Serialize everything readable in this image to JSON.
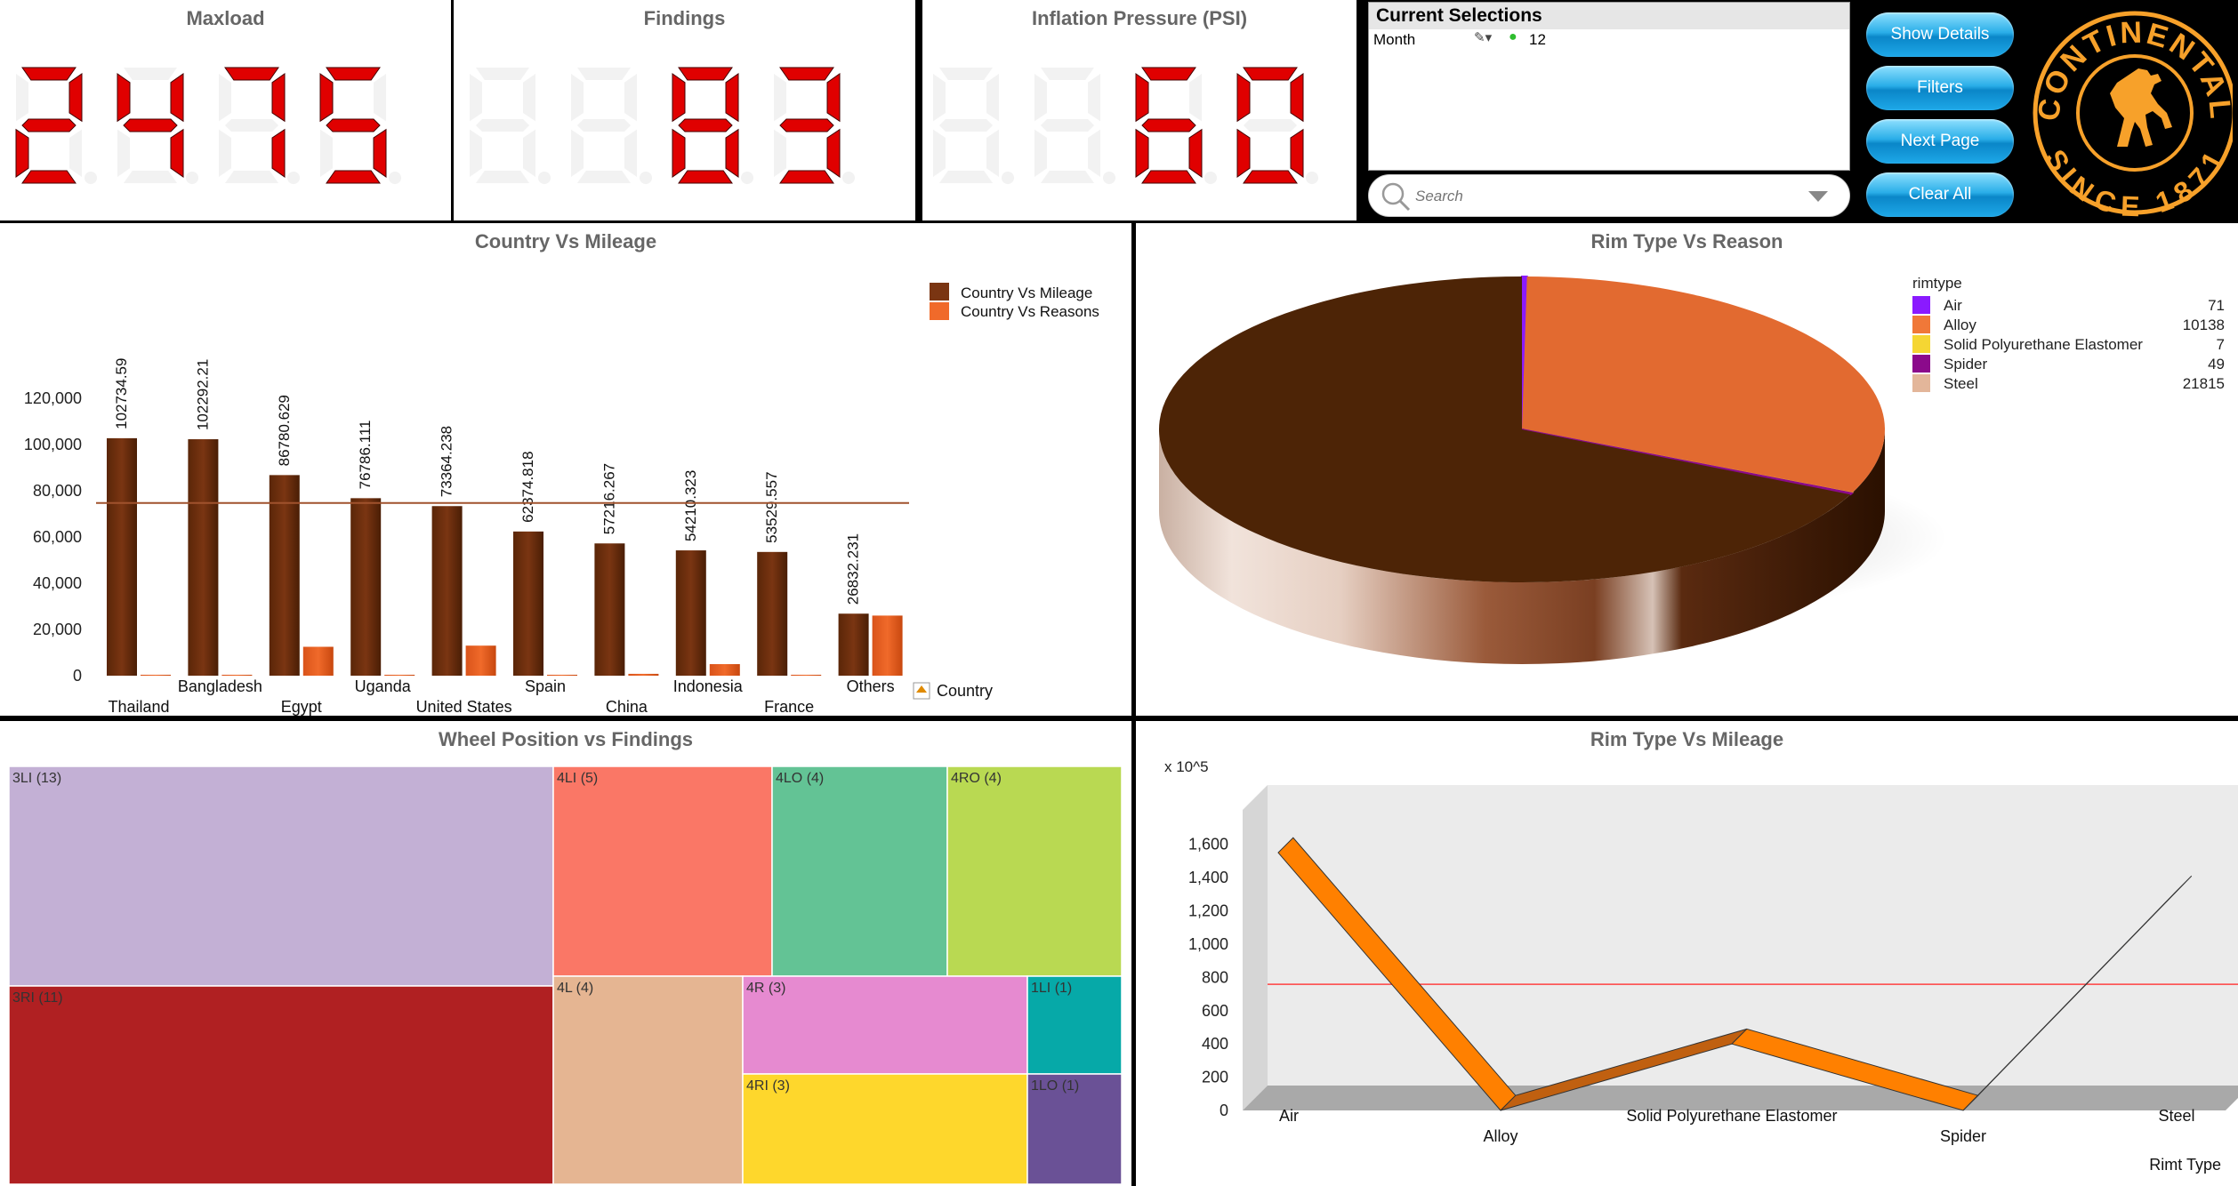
{
  "kpis": [
    {
      "title": "Maxload",
      "digits": "2475"
    },
    {
      "title": "Findings",
      "digits": "83"
    },
    {
      "title": "Inflation Pressure (PSI)",
      "digits": "60"
    }
  ],
  "selections": {
    "title": "Current Selections",
    "field": "Month",
    "value": "12",
    "search_placeholder": "Search"
  },
  "buttons": {
    "show_details": "Show Details",
    "filters": "Filters",
    "next_page": "Next Page",
    "clear_all": "Clear All"
  },
  "logo": {
    "brand": "CONTINENTAL",
    "since": "SINCE 1871"
  },
  "colors": {
    "mileage_bar": "#7a3512",
    "reasons_bar": "#f06a2a",
    "ref_line": "#a0522d",
    "kpi_digit": "#e00000",
    "logo_orange": "#f7a12a"
  },
  "chart_data": [
    {
      "type": "bar",
      "title": "Country Vs Mileage",
      "dimension_label": "Country",
      "categories": [
        "Thailand",
        "Bangladesh",
        "Egypt",
        "Uganda",
        "United States",
        "Spain",
        "China",
        "Indonesia",
        "France",
        "Others"
      ],
      "series": [
        {
          "name": "Country Vs Mileage",
          "values": [
            102734.59,
            102292.21,
            86780.629,
            76786.111,
            73364.238,
            62374.818,
            57216.267,
            54210.323,
            53529.557,
            26832.231
          ],
          "labels": [
            "102734.59",
            "102292.21",
            "86780.629",
            "76786.111",
            "73364.238",
            "62374.818",
            "57216.267",
            "54210.323",
            "53529.557",
            "26832.231"
          ]
        },
        {
          "name": "Country Vs Reasons",
          "values": [
            400,
            400,
            12500,
            400,
            13000,
            400,
            800,
            5000,
            400,
            26000
          ]
        }
      ],
      "reference_line": 74700,
      "ylim": [
        0,
        130000
      ],
      "yticks": [
        0,
        20000,
        40000,
        60000,
        80000,
        100000,
        120000
      ],
      "ytick_labels": [
        "0",
        "20,000",
        "40,000",
        "60,000",
        "80,000",
        "100,000",
        "120,000"
      ],
      "legend_position": "top-right"
    },
    {
      "type": "pie",
      "title": "Rim Type Vs Reason",
      "legend_title": "rimtype",
      "slices": [
        {
          "label": "Air",
          "value": 71,
          "color": "#8a1aff"
        },
        {
          "label": "Alloy",
          "value": 10138,
          "color": "#f07838"
        },
        {
          "label": "Solid Polyurethane Elastomer",
          "value": 7,
          "color": "#f5d633"
        },
        {
          "label": "Spider",
          "value": 49,
          "color": "#8b0a8b"
        },
        {
          "label": "Steel",
          "value": 21815,
          "color": "#e3b69a"
        }
      ],
      "legend_position": "top-right"
    },
    {
      "type": "heatmap",
      "title": "Wheel Position vs Findings",
      "cells": [
        {
          "label": "3LI (13)",
          "value": 13,
          "color": "#c3b0d5"
        },
        {
          "label": "3RI (11)",
          "value": 11,
          "color": "#b02022"
        },
        {
          "label": "4LI (5)",
          "value": 5,
          "color": "#fa7766"
        },
        {
          "label": "4LO (4)",
          "value": 4,
          "color": "#63c395"
        },
        {
          "label": "4RO (4)",
          "value": 4,
          "color": "#b9d952"
        },
        {
          "label": "4L (4)",
          "value": 4,
          "color": "#e5b592"
        },
        {
          "label": "4R (3)",
          "value": 3,
          "color": "#e68ad0"
        },
        {
          "label": "4RI (3)",
          "value": 3,
          "color": "#fed72c"
        },
        {
          "label": "1LI (1)",
          "value": 1,
          "color": "#06a9a8"
        },
        {
          "label": "1LO (1)",
          "value": 1,
          "color": "#6a5196"
        }
      ]
    },
    {
      "type": "line",
      "title": "Rim Type Vs Mileage",
      "unit_label": "x 10^5",
      "xlabel": "Rimt Type",
      "categories": [
        "Air",
        "Alloy",
        "Solid Polyurethane Elastomer",
        "Spider",
        "Steel"
      ],
      "series": [
        {
          "values": [
            1550,
            0,
            400,
            0,
            1320
          ]
        }
      ],
      "reference_line": 630,
      "ylim": [
        0,
        1700
      ],
      "yticks": [
        0,
        200,
        400,
        600,
        800,
        1000,
        1200,
        1400,
        1600
      ],
      "ytick_labels": [
        "0",
        "200",
        "400",
        "600",
        "800",
        "1,000",
        "1,200",
        "1,400",
        "1,600"
      ],
      "line_color": "#ff8000"
    }
  ]
}
